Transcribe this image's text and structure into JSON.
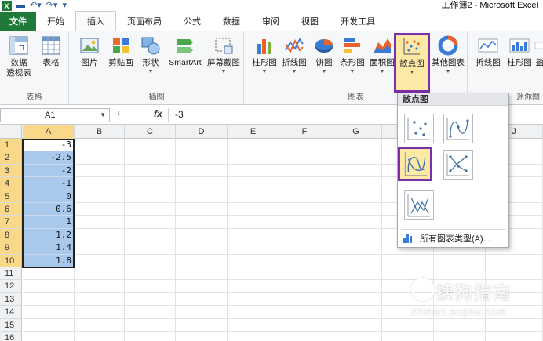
{
  "window": {
    "title": "工作簿2 - Microsoft Excel",
    "qat": {
      "logo": "X",
      "save_icon": "save-icon",
      "undo_icon": "undo-icon",
      "redo_icon": "redo-icon"
    }
  },
  "tabs": [
    {
      "label": "文件",
      "active": false
    },
    {
      "label": "开始",
      "active": false
    },
    {
      "label": "插入",
      "active": true
    },
    {
      "label": "页面布局",
      "active": false
    },
    {
      "label": "公式",
      "active": false
    },
    {
      "label": "数据",
      "active": false
    },
    {
      "label": "审阅",
      "active": false
    },
    {
      "label": "视图",
      "active": false
    },
    {
      "label": "开发工具",
      "active": false
    }
  ],
  "ribbon": {
    "groups": {
      "tables": "表格",
      "illustrations": "插图",
      "charts": "图表",
      "sparklines": "迷你图"
    },
    "buttons": {
      "pivot": "数据\n透视表",
      "pivot_line1": "数据",
      "pivot_line2": "透视表",
      "table": "表格",
      "picture": "图片",
      "clipart": "剪贴画",
      "shapes": "形状",
      "smartart": "SmartArt",
      "screenshot": "屏幕截图",
      "column": "柱形图",
      "line": "折线图",
      "pie": "饼图",
      "bar": "条形图",
      "area": "面积图",
      "scatter": "散点图",
      "other": "其他图表",
      "spark_line": "折线图",
      "spark_column": "柱形图",
      "spark_winloss": "盈"
    }
  },
  "formula_bar": {
    "name_box": "A1",
    "fx": "fx",
    "value": "-3"
  },
  "grid": {
    "columns": [
      "A",
      "B",
      "C",
      "D",
      "E",
      "F",
      "G",
      "H",
      "I",
      "J"
    ],
    "rows": [
      "1",
      "2",
      "3",
      "4",
      "5",
      "6",
      "7",
      "8",
      "9",
      "10",
      "11",
      "12",
      "13",
      "14",
      "15",
      "16"
    ],
    "colA_values": [
      "-3",
      "-2.5",
      "-2",
      "-1",
      "0",
      "0.6",
      "1",
      "1.2",
      "1.4",
      "1.8"
    ]
  },
  "dropdown": {
    "header": "散点图",
    "all_types": "所有图表类型(A)..."
  },
  "watermark": {
    "text": "搜狗指南",
    "url": "zhinan.sogou.com"
  },
  "colors": {
    "accent": "#1f7a3a",
    "highlight": "#7b2ea8",
    "selection": "#a9c9ec"
  }
}
